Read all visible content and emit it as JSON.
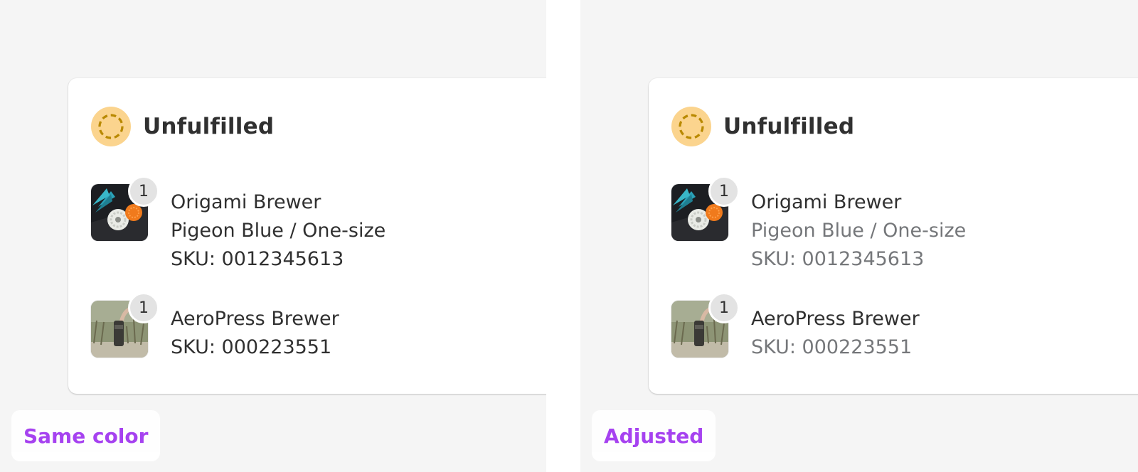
{
  "colors": {
    "background": "#f5f5f5",
    "card": "#ffffff",
    "status_badge": "#fbd48e",
    "status_ring": "#b98900",
    "primary_text": "#303030",
    "secondary_text": "#75777a",
    "tag_text": "#a033f0"
  },
  "left": {
    "card": {
      "title": "Unfulfilled",
      "status_icon": "unfulfilled-dashed-circle-icon",
      "items": [
        {
          "name": "Origami Brewer",
          "variant": "Pigeon Blue / One-size",
          "sku": "SKU: 0012345613",
          "quantity": "1"
        },
        {
          "name": "AeroPress Brewer",
          "sku": "SKU: 000223551",
          "quantity": "1"
        }
      ]
    },
    "tag": "Same color"
  },
  "right": {
    "card": {
      "title": "Unfulfilled",
      "status_icon": "unfulfilled-dashed-circle-icon",
      "items": [
        {
          "name": "Origami Brewer",
          "variant": "Pigeon Blue / One-size",
          "sku": "SKU: 0012345613",
          "quantity": "1"
        },
        {
          "name": "AeroPress Brewer",
          "sku": "SKU: 000223551",
          "quantity": "1"
        }
      ]
    },
    "tag": "Adjusted"
  }
}
